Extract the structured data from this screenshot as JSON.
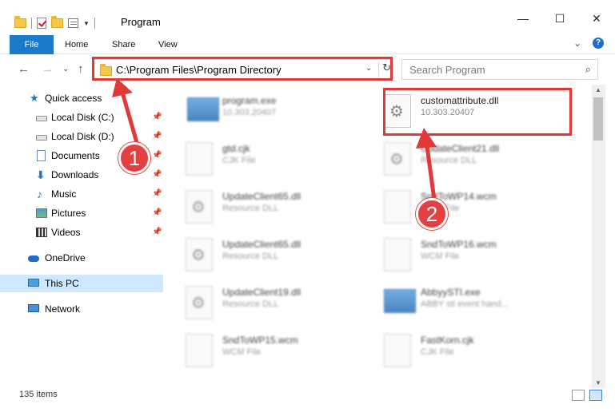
{
  "window": {
    "title": "Program",
    "minimize": "—",
    "maximize": "☐",
    "close": "✕"
  },
  "ribbon": {
    "tabs": [
      "File",
      "Home",
      "Share",
      "View"
    ],
    "expand": "⌄",
    "help": "?"
  },
  "nav": {
    "back": "←",
    "forward": "→",
    "recent": "⌄",
    "up": "↑"
  },
  "address": {
    "path": "C:\\Program Files\\Program Directory",
    "dropdown": "⌄",
    "refresh": "↻"
  },
  "search": {
    "placeholder": "Search Program",
    "icon": "⌕"
  },
  "sidebar": {
    "items": [
      {
        "label": "Quick access",
        "icon": "star-icon"
      },
      {
        "label": "Local Disk (C:)",
        "icon": "disk-icon",
        "pinned": true
      },
      {
        "label": "Local Disk (D:)",
        "icon": "disk-icon",
        "pinned": true
      },
      {
        "label": "Documents",
        "icon": "documents-icon",
        "pinned": true
      },
      {
        "label": "Downloads",
        "icon": "download-icon",
        "pinned": true
      },
      {
        "label": "Music",
        "icon": "music-icon",
        "pinned": true
      },
      {
        "label": "Pictures",
        "icon": "pictures-icon",
        "pinned": true
      },
      {
        "label": "Videos",
        "icon": "videos-icon",
        "pinned": true
      },
      {
        "label": "OneDrive",
        "icon": "cloud-icon"
      },
      {
        "label": "This PC",
        "icon": "computer-icon",
        "selected": true
      },
      {
        "label": "Network",
        "icon": "network-icon"
      }
    ],
    "pin_glyph": "📌"
  },
  "files": [
    {
      "name": "program.exe",
      "meta": "10.303.20407",
      "icon": "program-icon"
    },
    {
      "name": "customattribute.dll",
      "meta": "10.303.20407",
      "icon": "dll-gear-icon"
    },
    {
      "name": "gtd.cjk",
      "meta": "CJK File",
      "icon": "file-icon"
    },
    {
      "name": "UpdateClient21.dll",
      "meta": "Resource DLL",
      "icon": "dll-gear-icon"
    },
    {
      "name": "UpdateClient65.dll",
      "meta": "Resource DLL",
      "icon": "dll-gear-icon"
    },
    {
      "name": "SndToWP14.wcm",
      "meta": "WCM File",
      "icon": "file-icon"
    },
    {
      "name": "UpdateClient65.dll",
      "meta": "Resource DLL",
      "icon": "dll-gear-icon"
    },
    {
      "name": "SndToWP16.wcm",
      "meta": "WCM File",
      "icon": "file-icon"
    },
    {
      "name": "UpdateClient19.dll",
      "meta": "Resource DLL",
      "icon": "dll-gear-icon"
    },
    {
      "name": "AbbyySTI.exe",
      "meta": "ABBY sti event hand...",
      "icon": "exe-icon"
    },
    {
      "name": "SndToWP15.wcm",
      "meta": "WCM File",
      "icon": "file-icon"
    },
    {
      "name": "FastKorn.cjk",
      "meta": "CJK File",
      "icon": "file-icon"
    }
  ],
  "status": {
    "count": "135 items"
  },
  "callouts": {
    "one": "1",
    "two": "2",
    "color": "#e23838"
  }
}
